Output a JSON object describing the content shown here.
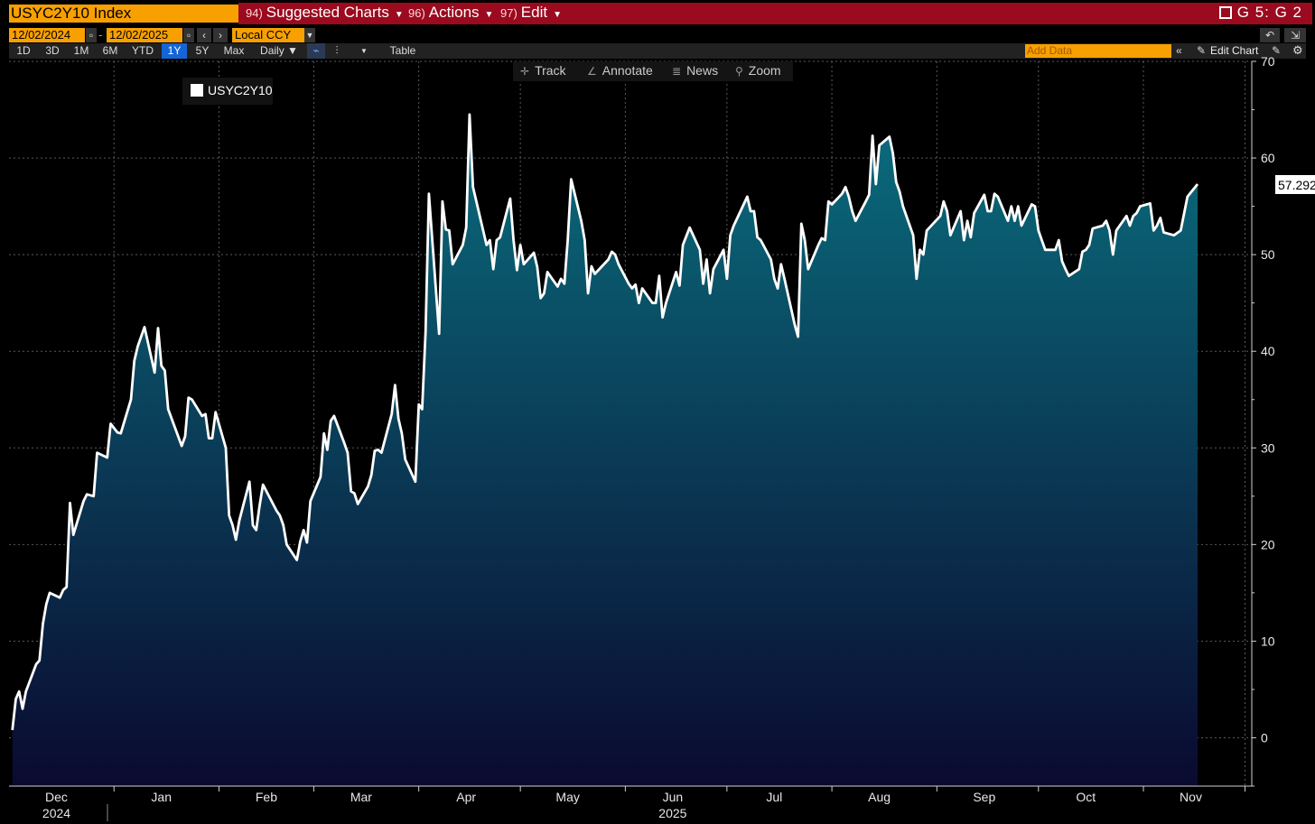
{
  "header": {
    "ticker": "USYC2Y10 Index",
    "menus": [
      {
        "num": "94)",
        "label": "Suggested Charts"
      },
      {
        "num": "96)",
        "label": "Actions"
      },
      {
        "num": "97)",
        "label": "Edit"
      }
    ],
    "gcode": "G 5: G 2"
  },
  "controls": {
    "start_date": "12/02/2024",
    "end_date": "12/02/2025",
    "currency": "Local CCY",
    "periods": [
      "1D",
      "3D",
      "1M",
      "6M",
      "YTD",
      "1Y",
      "5Y",
      "Max"
    ],
    "active_period": "1Y",
    "frequency": "Daily ▼",
    "table_label": "Table",
    "add_data_placeholder": "Add Data",
    "edit_chart_label": "Edit Chart"
  },
  "toolbar": {
    "track": "Track",
    "annotate": "Annotate",
    "news": "News",
    "zoom": "Zoom"
  },
  "colors": {
    "accent_orange": "#f7a000",
    "header_red": "#9b0a1e",
    "line": "#ffffff",
    "area_top": "#0a6d7d",
    "area_bottom": "#0a0a30",
    "active_button": "#1565d8"
  },
  "chart_data": {
    "type": "area",
    "series": [
      {
        "name": "USYC2Y10",
        "last_value": "57.2923"
      }
    ],
    "ylim": [
      -5,
      70
    ],
    "yticks": [
      0,
      10,
      20,
      30,
      40,
      50,
      60,
      70
    ],
    "xlim": [
      "2024-12-01",
      "2025-12-03"
    ],
    "xtick_labels": [
      {
        "label": "Dec",
        "date": "2024-12-15"
      },
      {
        "label": "Jan",
        "date": "2025-01-15"
      },
      {
        "label": "Feb",
        "date": "2025-02-15"
      },
      {
        "label": "Mar",
        "date": "2025-03-15"
      },
      {
        "label": "Apr",
        "date": "2025-04-15"
      },
      {
        "label": "May",
        "date": "2025-05-15"
      },
      {
        "label": "Jun",
        "date": "2025-06-15"
      },
      {
        "label": "Jul",
        "date": "2025-07-15"
      },
      {
        "label": "Aug",
        "date": "2025-08-15"
      },
      {
        "label": "Sep",
        "date": "2025-09-15"
      },
      {
        "label": "Oct",
        "date": "2025-10-15"
      },
      {
        "label": "Nov",
        "date": "2025-11-15"
      }
    ],
    "year_labels": [
      {
        "label": "2024",
        "date": "2024-12-15"
      },
      {
        "label": "2025",
        "date": "2025-06-15"
      }
    ],
    "grid": true,
    "legend_position": "top-left",
    "points": [
      [
        "2024-12-02",
        0.8
      ],
      [
        "2024-12-03",
        4.0
      ],
      [
        "2024-12-04",
        4.8
      ],
      [
        "2024-12-05",
        3.0
      ],
      [
        "2024-12-06",
        4.8
      ],
      [
        "2024-12-09",
        7.6
      ],
      [
        "2024-12-10",
        8.0
      ],
      [
        "2024-12-11",
        11.8
      ],
      [
        "2024-12-12",
        13.8
      ],
      [
        "2024-12-13",
        15.0
      ],
      [
        "2024-12-16",
        14.5
      ],
      [
        "2024-12-17",
        15.3
      ],
      [
        "2024-12-18",
        15.6
      ],
      [
        "2024-12-19",
        24.3
      ],
      [
        "2024-12-20",
        21.0
      ],
      [
        "2024-12-23",
        24.5
      ],
      [
        "2024-12-24",
        25.2
      ],
      [
        "2024-12-26",
        25.0
      ],
      [
        "2024-12-27",
        29.5
      ],
      [
        "2024-12-30",
        29.0
      ],
      [
        "2024-12-31",
        32.5
      ],
      [
        "2025-01-02",
        31.6
      ],
      [
        "2025-01-03",
        31.5
      ],
      [
        "2025-01-06",
        35.0
      ],
      [
        "2025-01-07",
        39.0
      ],
      [
        "2025-01-08",
        40.5
      ],
      [
        "2025-01-10",
        42.5
      ],
      [
        "2025-01-13",
        37.8
      ],
      [
        "2025-01-14",
        42.4
      ],
      [
        "2025-01-15",
        38.5
      ],
      [
        "2025-01-16",
        38.0
      ],
      [
        "2025-01-17",
        34.0
      ],
      [
        "2025-01-21",
        30.2
      ],
      [
        "2025-01-22",
        31.2
      ],
      [
        "2025-01-23",
        35.2
      ],
      [
        "2025-01-24",
        35.0
      ],
      [
        "2025-01-27",
        33.3
      ],
      [
        "2025-01-28",
        33.5
      ],
      [
        "2025-01-29",
        31.0
      ],
      [
        "2025-01-30",
        31.0
      ],
      [
        "2025-01-31",
        33.7
      ],
      [
        "2025-02-03",
        30.0
      ],
      [
        "2025-02-04",
        23.0
      ],
      [
        "2025-02-05",
        22.0
      ],
      [
        "2025-02-06",
        20.5
      ],
      [
        "2025-02-07",
        22.5
      ],
      [
        "2025-02-10",
        26.5
      ],
      [
        "2025-02-11",
        22.0
      ],
      [
        "2025-02-12",
        21.5
      ],
      [
        "2025-02-13",
        24.0
      ],
      [
        "2025-02-14",
        26.2
      ],
      [
        "2025-02-18",
        23.5
      ],
      [
        "2025-02-19",
        23.0
      ],
      [
        "2025-02-20",
        22.0
      ],
      [
        "2025-02-21",
        20.0
      ],
      [
        "2025-02-24",
        18.4
      ],
      [
        "2025-02-25",
        20.3
      ],
      [
        "2025-02-26",
        21.5
      ],
      [
        "2025-02-27",
        20.2
      ],
      [
        "2025-02-28",
        24.5
      ],
      [
        "2025-03-03",
        27.0
      ],
      [
        "2025-03-04",
        31.5
      ],
      [
        "2025-03-05",
        29.8
      ],
      [
        "2025-03-06",
        32.8
      ],
      [
        "2025-03-07",
        33.3
      ],
      [
        "2025-03-10",
        30.5
      ],
      [
        "2025-03-11",
        29.5
      ],
      [
        "2025-03-12",
        25.5
      ],
      [
        "2025-03-13",
        25.3
      ],
      [
        "2025-03-14",
        24.2
      ],
      [
        "2025-03-17",
        26.0
      ],
      [
        "2025-03-18",
        27.2
      ],
      [
        "2025-03-19",
        29.7
      ],
      [
        "2025-03-20",
        29.8
      ],
      [
        "2025-03-21",
        29.5
      ],
      [
        "2025-03-24",
        33.5
      ],
      [
        "2025-03-25",
        36.5
      ],
      [
        "2025-03-26",
        33.0
      ],
      [
        "2025-03-27",
        31.5
      ],
      [
        "2025-03-28",
        28.8
      ],
      [
        "2025-03-31",
        26.5
      ],
      [
        "2025-04-01",
        34.5
      ],
      [
        "2025-04-02",
        34.0
      ],
      [
        "2025-04-03",
        42.0
      ],
      [
        "2025-04-04",
        56.3
      ],
      [
        "2025-04-07",
        41.8
      ],
      [
        "2025-04-08",
        55.5
      ],
      [
        "2025-04-09",
        52.6
      ],
      [
        "2025-04-10",
        52.5
      ],
      [
        "2025-04-11",
        49.0
      ],
      [
        "2025-04-14",
        51.0
      ],
      [
        "2025-04-15",
        52.8
      ],
      [
        "2025-04-16",
        64.5
      ],
      [
        "2025-04-17",
        57.0
      ],
      [
        "2025-04-21",
        51.0
      ],
      [
        "2025-04-22",
        51.5
      ],
      [
        "2025-04-23",
        48.5
      ],
      [
        "2025-04-24",
        51.5
      ],
      [
        "2025-04-25",
        51.8
      ],
      [
        "2025-04-28",
        55.8
      ],
      [
        "2025-04-29",
        51.5
      ],
      [
        "2025-04-30",
        48.4
      ],
      [
        "2025-05-01",
        51.0
      ],
      [
        "2025-05-02",
        49.0
      ],
      [
        "2025-05-05",
        50.2
      ],
      [
        "2025-05-06",
        48.7
      ],
      [
        "2025-05-07",
        45.5
      ],
      [
        "2025-05-08",
        46.0
      ],
      [
        "2025-05-09",
        48.2
      ],
      [
        "2025-05-12",
        46.7
      ],
      [
        "2025-05-13",
        47.5
      ],
      [
        "2025-05-14",
        47.0
      ],
      [
        "2025-05-15",
        51.5
      ],
      [
        "2025-05-16",
        57.8
      ],
      [
        "2025-05-19",
        53.5
      ],
      [
        "2025-05-20",
        51.5
      ],
      [
        "2025-05-21",
        46.0
      ],
      [
        "2025-05-22",
        48.8
      ],
      [
        "2025-05-23",
        48.0
      ],
      [
        "2025-05-27",
        49.5
      ],
      [
        "2025-05-28",
        50.3
      ],
      [
        "2025-05-29",
        50.0
      ],
      [
        "2025-05-30",
        49.0
      ],
      [
        "2025-06-02",
        47.0
      ],
      [
        "2025-06-03",
        46.5
      ],
      [
        "2025-06-04",
        46.9
      ],
      [
        "2025-06-05",
        45.0
      ],
      [
        "2025-06-06",
        46.5
      ],
      [
        "2025-06-09",
        45.0
      ],
      [
        "2025-06-10",
        45.0
      ],
      [
        "2025-06-11",
        47.8
      ],
      [
        "2025-06-12",
        43.5
      ],
      [
        "2025-06-13",
        45.0
      ],
      [
        "2025-06-16",
        48.2
      ],
      [
        "2025-06-17",
        46.8
      ],
      [
        "2025-06-18",
        51.0
      ],
      [
        "2025-06-20",
        52.8
      ],
      [
        "2025-06-23",
        50.5
      ],
      [
        "2025-06-24",
        47.0
      ],
      [
        "2025-06-25",
        49.5
      ],
      [
        "2025-06-26",
        46.0
      ],
      [
        "2025-06-27",
        48.5
      ],
      [
        "2025-06-30",
        50.5
      ],
      [
        "2025-07-01",
        47.5
      ],
      [
        "2025-07-02",
        52.0
      ],
      [
        "2025-07-03",
        53.0
      ],
      [
        "2025-07-07",
        56.0
      ],
      [
        "2025-07-08",
        54.5
      ],
      [
        "2025-07-09",
        54.5
      ],
      [
        "2025-07-10",
        51.8
      ],
      [
        "2025-07-11",
        51.5
      ],
      [
        "2025-07-14",
        49.5
      ],
      [
        "2025-07-15",
        47.5
      ],
      [
        "2025-07-16",
        46.5
      ],
      [
        "2025-07-17",
        49.0
      ],
      [
        "2025-07-18",
        47.5
      ],
      [
        "2025-07-21",
        42.8
      ],
      [
        "2025-07-22",
        41.5
      ],
      [
        "2025-07-23",
        53.2
      ],
      [
        "2025-07-24",
        51.5
      ],
      [
        "2025-07-25",
        48.5
      ],
      [
        "2025-07-28",
        51.0
      ],
      [
        "2025-07-29",
        51.7
      ],
      [
        "2025-07-30",
        51.5
      ],
      [
        "2025-07-31",
        55.5
      ],
      [
        "2025-08-01",
        55.2
      ],
      [
        "2025-08-04",
        56.3
      ],
      [
        "2025-08-05",
        57.0
      ],
      [
        "2025-08-06",
        56.0
      ],
      [
        "2025-08-07",
        54.5
      ],
      [
        "2025-08-08",
        53.5
      ],
      [
        "2025-08-11",
        55.5
      ],
      [
        "2025-08-12",
        56.2
      ],
      [
        "2025-08-13",
        62.3
      ],
      [
        "2025-08-14",
        57.3
      ],
      [
        "2025-08-15",
        61.3
      ],
      [
        "2025-08-18",
        62.2
      ],
      [
        "2025-08-19",
        60.5
      ],
      [
        "2025-08-20",
        57.5
      ],
      [
        "2025-08-21",
        56.5
      ],
      [
        "2025-08-22",
        55.0
      ],
      [
        "2025-08-25",
        52.0
      ],
      [
        "2025-08-26",
        47.5
      ],
      [
        "2025-08-27",
        50.5
      ],
      [
        "2025-08-28",
        50.0
      ],
      [
        "2025-08-29",
        52.5
      ],
      [
        "2025-09-02",
        54.0
      ],
      [
        "2025-09-03",
        55.5
      ],
      [
        "2025-09-04",
        54.5
      ],
      [
        "2025-09-05",
        52.0
      ],
      [
        "2025-09-08",
        54.5
      ],
      [
        "2025-09-09",
        51.5
      ],
      [
        "2025-09-10",
        53.5
      ],
      [
        "2025-09-11",
        51.8
      ],
      [
        "2025-09-12",
        54.3
      ],
      [
        "2025-09-15",
        56.2
      ],
      [
        "2025-09-16",
        54.5
      ],
      [
        "2025-09-17",
        54.5
      ],
      [
        "2025-09-18",
        56.3
      ],
      [
        "2025-09-19",
        56.0
      ],
      [
        "2025-09-22",
        53.5
      ],
      [
        "2025-09-23",
        55.0
      ],
      [
        "2025-09-24",
        53.5
      ],
      [
        "2025-09-25",
        55.0
      ],
      [
        "2025-09-26",
        53.0
      ],
      [
        "2025-09-29",
        55.2
      ],
      [
        "2025-09-30",
        55.0
      ],
      [
        "2025-10-01",
        52.5
      ],
      [
        "2025-10-02",
        51.5
      ],
      [
        "2025-10-03",
        50.5
      ],
      [
        "2025-10-06",
        50.5
      ],
      [
        "2025-10-07",
        51.5
      ],
      [
        "2025-10-08",
        49.3
      ],
      [
        "2025-10-09",
        48.5
      ],
      [
        "2025-10-10",
        47.8
      ],
      [
        "2025-10-13",
        48.5
      ],
      [
        "2025-10-14",
        50.3
      ],
      [
        "2025-10-15",
        50.5
      ],
      [
        "2025-10-16",
        51.0
      ],
      [
        "2025-10-17",
        52.7
      ],
      [
        "2025-10-20",
        53.0
      ],
      [
        "2025-10-21",
        53.5
      ],
      [
        "2025-10-22",
        52.5
      ],
      [
        "2025-10-23",
        50.0
      ],
      [
        "2025-10-24",
        52.5
      ],
      [
        "2025-10-27",
        54.0
      ],
      [
        "2025-10-28",
        53.0
      ],
      [
        "2025-10-29",
        54.0
      ],
      [
        "2025-10-30",
        54.3
      ],
      [
        "2025-10-31",
        55.0
      ],
      [
        "2025-11-03",
        55.3
      ],
      [
        "2025-11-04",
        52.5
      ],
      [
        "2025-11-05",
        53.0
      ],
      [
        "2025-11-06",
        53.8
      ],
      [
        "2025-11-07",
        52.3
      ],
      [
        "2025-11-10",
        52.0
      ],
      [
        "2025-11-12",
        52.5
      ],
      [
        "2025-11-14",
        56.0
      ],
      [
        "2025-11-17",
        57.3
      ]
    ]
  }
}
